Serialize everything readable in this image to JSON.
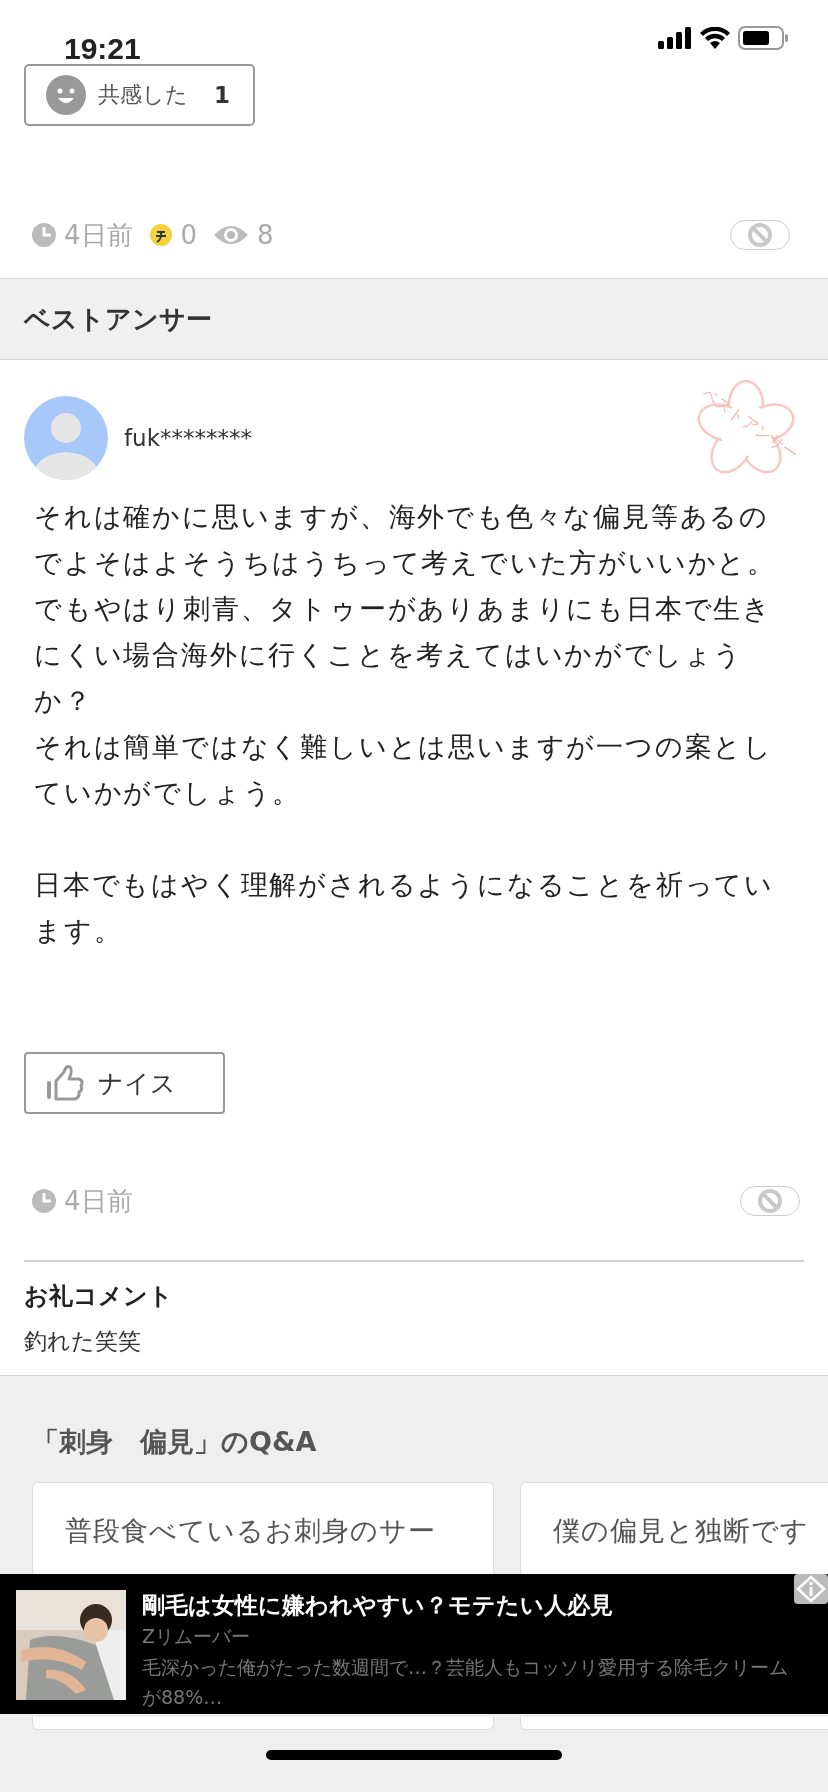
{
  "status_bar": {
    "time": "19:21"
  },
  "empathy_button": {
    "label": "共感した",
    "count": "1"
  },
  "question_meta": {
    "time": "4日前",
    "coins": "0",
    "views": "8"
  },
  "best_answer": {
    "heading": "ベストアンサー",
    "stamp_text": "ベストアンサー",
    "user": "fuk********",
    "paragraphs": [
      [
        "それは確かに思いますが、海外でも色々な偏見等あるのでよそはよそうちはうちって考えでいた方がいいかと。でもやはり刺青、タトゥーがありあまりにも日本で生きにくい場合海外に行くことを考えてはいかがでしょうか？",
        "それは簡単ではなく難しいとは思いますが一つの案としていかがでしょう。"
      ],
      [
        "日本でもはやく理解がされるようになることを祈っています。"
      ]
    ],
    "nice_button": "ナイス",
    "time": "4日前",
    "thanks": {
      "heading": "お礼コメント",
      "text": "釣れた笑笑"
    }
  },
  "related": {
    "heading": "「刺身　偏見」のQ&A",
    "cards": [
      {
        "title": "普段食べているお刺身のサー"
      },
      {
        "title": "僕の偏見と独断です"
      }
    ]
  },
  "ad": {
    "title": "剛毛は女性に嫌われやすい？モテたい人必見",
    "sponsor": "Zリムーバー",
    "description": "毛深かった俺がたった数週間で…？芸能人もコッソリ愛用する除毛クリームが88%…"
  }
}
